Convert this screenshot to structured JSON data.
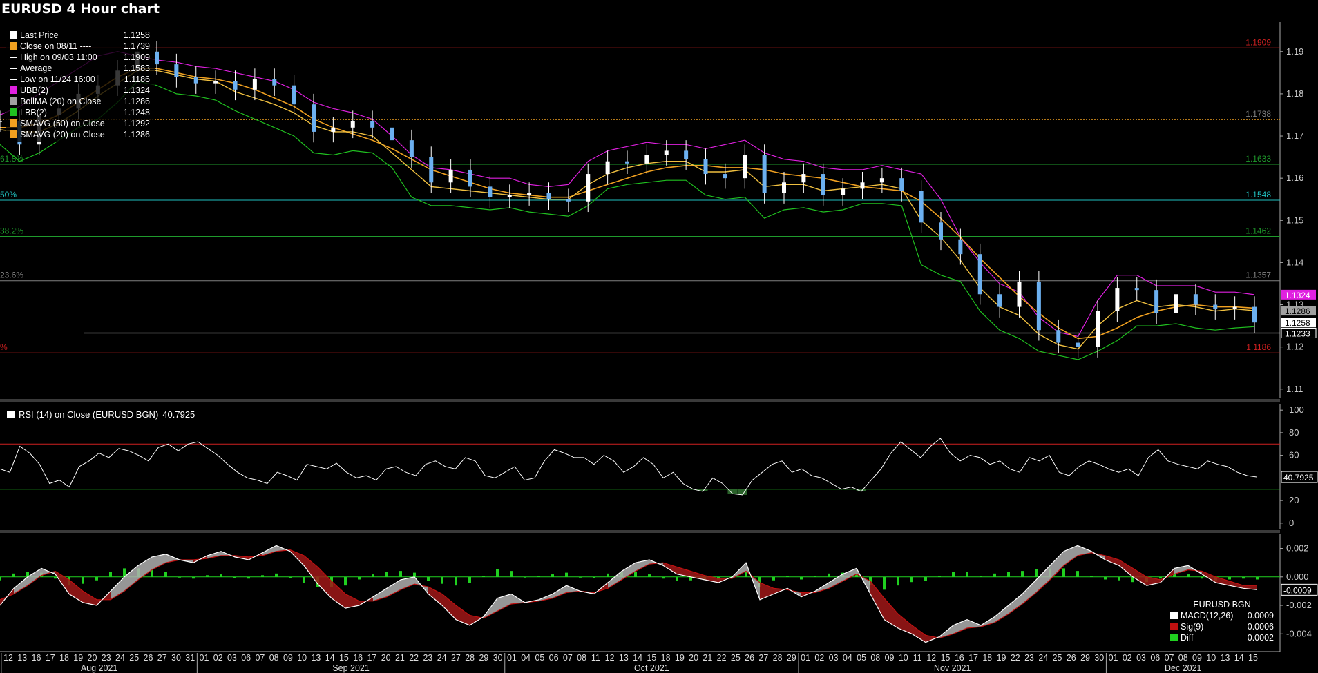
{
  "title": "EURUSD 4 Hour chart",
  "colors": {
    "price": "#6cb0f0",
    "upper_band": "#e020e0",
    "lower_band": "#20c020",
    "sma50": "#f0a020",
    "sma20": "#f0c040",
    "fib_red": "#d02020",
    "fib_green": "#1f9a2c",
    "fib_cyan": "#20c0c0",
    "fib_gray": "#808080",
    "rsi": "#ffffff",
    "macd": "#ffffff",
    "signal": "#c01010",
    "diff": "#20d020"
  },
  "legend": [
    {
      "label": "Last Price",
      "value": "1.1258",
      "color": "#ffffff",
      "icon": "square"
    },
    {
      "label": "Close on 08/11 ----",
      "value": "1.1739",
      "color": "#f0a020",
      "icon": "square"
    },
    {
      "label": "High on 09/03 11:00",
      "value": "1.1909",
      "color": "#ffffff",
      "icon": "high-marker-icon"
    },
    {
      "label": "Average",
      "value": "1.1583",
      "color": "#ffffff",
      "icon": "average-marker-icon"
    },
    {
      "label": "Low on 11/24 16:00",
      "value": "1.1186",
      "color": "#ffffff",
      "icon": "low-marker-icon"
    },
    {
      "label": "UBB(2)",
      "value": "1.1324",
      "color": "#e020e0",
      "icon": "square"
    },
    {
      "label": "BollMA (20)  on Close",
      "value": "1.1286",
      "color": "#a0a0a0",
      "icon": "square"
    },
    {
      "label": "LBB(2)",
      "value": "1.1248",
      "color": "#20c020",
      "icon": "square"
    },
    {
      "label": "SMAVG (50)  on Close",
      "value": "1.1292",
      "color": "#f0a020",
      "icon": "square"
    },
    {
      "label": "SMAVG (20)  on Close",
      "value": "1.1286",
      "color": "#f0a020",
      "icon": "square"
    }
  ],
  "fib_labels": [
    {
      "text": "",
      "value": 1.1909,
      "color": "#d02020",
      "right": "1.1909"
    },
    {
      "text": "61.8%",
      "value": 1.1633,
      "color": "#1f9a2c",
      "right": "1.1633"
    },
    {
      "text": "50%",
      "value": 1.1548,
      "color": "#20c0c0",
      "right": "1.1548"
    },
    {
      "text": "38.2%",
      "value": 1.1462,
      "color": "#1f9a2c",
      "right": "1.1462"
    },
    {
      "text": "23.6%",
      "value": 1.1357,
      "color": "#808080",
      "right": "1.1357"
    },
    {
      "text": "%",
      "value": 1.1186,
      "color": "#d02020",
      "right": "1.1186"
    }
  ],
  "close_line": {
    "value": 1.1739,
    "label": "1.1738"
  },
  "support_line": {
    "value": 1.1233
  },
  "price_badges": [
    {
      "text": "1.1324",
      "value": 1.1324,
      "bg": "#e020e0",
      "fg": "#ffffff"
    },
    {
      "text": "1.1286",
      "value": 1.1286,
      "bg": "#a0a0a0",
      "fg": "#000000"
    },
    {
      "text": "1.1258",
      "value": 1.1258,
      "bg": "#ffffff",
      "fg": "#000000"
    },
    {
      "text": "1.1233",
      "value": 1.1233,
      "bg": "#000000",
      "fg": "#ffffff"
    }
  ],
  "rsi_legend": {
    "label": "RSI (14)  on Close (EURUSD BGN)",
    "value": "40.7925"
  },
  "rsi_badge": "40.7925",
  "macd_legend": {
    "header": "EURUSD BGN",
    "rows": [
      {
        "label": "MACD(12,26)",
        "value": "-0.0009",
        "color": "#ffffff"
      },
      {
        "label": "Sig(9)",
        "value": "-0.0006",
        "color": "#c01010"
      },
      {
        "label": "Diff",
        "value": "-0.0002",
        "color": "#20d020"
      }
    ]
  },
  "macd_badge": "-0.0009",
  "chart_data": {
    "type": "line",
    "price_panel": {
      "ylim": [
        1.108,
        1.197
      ],
      "yticks": [
        "1.11",
        "1.12",
        "1.13",
        "1.14",
        "1.15",
        "1.16",
        "1.17",
        "1.18",
        "1.19"
      ],
      "close": [
        1.1735,
        1.168,
        1.175,
        1.1765,
        1.18,
        1.182,
        1.1855,
        1.19,
        1.187,
        1.184,
        1.1825,
        1.183,
        1.181,
        1.1835,
        1.182,
        1.1775,
        1.171,
        1.172,
        1.1735,
        1.172,
        1.169,
        1.165,
        1.159,
        1.162,
        1.158,
        1.1555,
        1.156,
        1.1565,
        1.155,
        1.1545,
        1.161,
        1.164,
        1.1635,
        1.1655,
        1.1665,
        1.1645,
        1.161,
        1.16,
        1.1655,
        1.1565,
        1.159,
        1.161,
        1.156,
        1.1575,
        1.159,
        1.16,
        1.157,
        1.1495,
        1.1455,
        1.142,
        1.1325,
        1.1295,
        1.1355,
        1.124,
        1.121,
        1.12,
        1.1285,
        1.134,
        1.1335,
        1.128,
        1.1325,
        1.13,
        1.129,
        1.1295,
        1.1258
      ],
      "upper_band": [
        1.175,
        1.177,
        1.18,
        1.183,
        1.186,
        1.189,
        1.19,
        1.189,
        1.188,
        1.1875,
        1.1865,
        1.186,
        1.185,
        1.184,
        1.183,
        1.181,
        1.178,
        1.1765,
        1.1755,
        1.174,
        1.17,
        1.1655,
        1.1625,
        1.162,
        1.161,
        1.16,
        1.16,
        1.1585,
        1.158,
        1.1585,
        1.164,
        1.1665,
        1.1675,
        1.1685,
        1.168,
        1.168,
        1.167,
        1.168,
        1.169,
        1.166,
        1.1645,
        1.164,
        1.1625,
        1.162,
        1.162,
        1.163,
        1.162,
        1.161,
        1.155,
        1.146,
        1.14,
        1.135,
        1.133,
        1.127,
        1.1235,
        1.1225,
        1.131,
        1.137,
        1.137,
        1.1345,
        1.1345,
        1.1345,
        1.133,
        1.133,
        1.1324
      ],
      "lower_band": [
        1.168,
        1.164,
        1.166,
        1.169,
        1.172,
        1.174,
        1.178,
        1.183,
        1.182,
        1.18,
        1.1795,
        1.1785,
        1.176,
        1.174,
        1.172,
        1.17,
        1.166,
        1.1655,
        1.1665,
        1.166,
        1.1625,
        1.1555,
        1.1535,
        1.1535,
        1.153,
        1.1525,
        1.153,
        1.152,
        1.1515,
        1.151,
        1.1535,
        1.1575,
        1.1585,
        1.159,
        1.1595,
        1.1595,
        1.156,
        1.155,
        1.1555,
        1.1505,
        1.1525,
        1.153,
        1.152,
        1.1525,
        1.154,
        1.154,
        1.1535,
        1.1395,
        1.137,
        1.1355,
        1.1285,
        1.124,
        1.122,
        1.119,
        1.118,
        1.117,
        1.119,
        1.1215,
        1.125,
        1.125,
        1.1255,
        1.1245,
        1.124,
        1.1245,
        1.1248
      ],
      "sma50": [
        1.172,
        1.172,
        1.173,
        1.175,
        1.178,
        1.181,
        1.184,
        1.186,
        1.186,
        1.185,
        1.184,
        1.1835,
        1.1825,
        1.181,
        1.179,
        1.177,
        1.174,
        1.172,
        1.1705,
        1.169,
        1.167,
        1.1645,
        1.162,
        1.1605,
        1.159,
        1.1575,
        1.1565,
        1.156,
        1.1555,
        1.1555,
        1.157,
        1.1585,
        1.16,
        1.1615,
        1.1625,
        1.163,
        1.163,
        1.1625,
        1.1625,
        1.162,
        1.161,
        1.1605,
        1.16,
        1.159,
        1.158,
        1.1575,
        1.157,
        1.1545,
        1.1505,
        1.146,
        1.141,
        1.1365,
        1.132,
        1.128,
        1.1245,
        1.122,
        1.1225,
        1.1245,
        1.127,
        1.1285,
        1.1295,
        1.13,
        1.1295,
        1.1295,
        1.1292
      ],
      "sma20": [
        1.1715,
        1.171,
        1.171,
        1.173,
        1.176,
        1.1795,
        1.1825,
        1.1855,
        1.1855,
        1.1845,
        1.1835,
        1.183,
        1.1805,
        1.179,
        1.1775,
        1.1755,
        1.1725,
        1.171,
        1.171,
        1.17,
        1.166,
        1.162,
        1.158,
        1.1575,
        1.157,
        1.1565,
        1.156,
        1.1555,
        1.155,
        1.155,
        1.1585,
        1.161,
        1.1625,
        1.1635,
        1.164,
        1.164,
        1.1615,
        1.1615,
        1.162,
        1.158,
        1.1585,
        1.1585,
        1.157,
        1.1575,
        1.158,
        1.1585,
        1.1575,
        1.15,
        1.146,
        1.1405,
        1.134,
        1.1295,
        1.1275,
        1.123,
        1.1205,
        1.1195,
        1.125,
        1.129,
        1.131,
        1.1295,
        1.13,
        1.1295,
        1.1285,
        1.129,
        1.1286
      ]
    },
    "rsi_panel": {
      "ylim": [
        -5,
        105
      ],
      "yticks": [
        "0",
        "20",
        "40",
        "60",
        "80",
        "100"
      ],
      "overbought": 70,
      "oversold": 30,
      "values": [
        48,
        45,
        68,
        62,
        52,
        35,
        38,
        32,
        50,
        55,
        62,
        58,
        66,
        64,
        60,
        55,
        67,
        70,
        64,
        70,
        72,
        66,
        60,
        52,
        45,
        40,
        38,
        35,
        45,
        42,
        38,
        52,
        50,
        48,
        53,
        45,
        40,
        42,
        38,
        48,
        50,
        45,
        42,
        52,
        55,
        50,
        48,
        58,
        55,
        42,
        40,
        45,
        50,
        38,
        40,
        55,
        65,
        62,
        58,
        58,
        52,
        60,
        55,
        45,
        50,
        58,
        52,
        40,
        45,
        35,
        30,
        28,
        40,
        35,
        26,
        25,
        38,
        45,
        52,
        55,
        45,
        48,
        42,
        40,
        35,
        30,
        32,
        28,
        38,
        48,
        62,
        72,
        65,
        58,
        68,
        75,
        62,
        55,
        60,
        58,
        52,
        55,
        48,
        45,
        58,
        55,
        60,
        45,
        42,
        50,
        55,
        52,
        48,
        45,
        48,
        42,
        58,
        65,
        55,
        52,
        50,
        48,
        55,
        52,
        50,
        45,
        42,
        40.79
      ]
    },
    "macd_panel": {
      "ylim": [
        -0.0052,
        0.0029
      ],
      "yticks": [
        "-0.004",
        "-0.002",
        "0.000",
        "0.002"
      ],
      "macd": [
        -0.002,
        -0.0008,
        0.0,
        0.0006,
        0.0002,
        -0.0012,
        -0.0018,
        -0.002,
        -0.001,
        0.0,
        0.0008,
        0.0014,
        0.0016,
        0.0012,
        0.001,
        0.0015,
        0.0018,
        0.0014,
        0.0012,
        0.0017,
        0.0022,
        0.0018,
        0.0008,
        -0.0005,
        -0.0015,
        -0.0022,
        -0.002,
        -0.0014,
        -0.0008,
        -0.0002,
        0.0,
        -0.0012,
        -0.002,
        -0.003,
        -0.0034,
        -0.0028,
        -0.0015,
        -0.0012,
        -0.0018,
        -0.0016,
        -0.0012,
        -0.0006,
        -0.001,
        -0.0012,
        -0.0004,
        0.0004,
        0.001,
        0.0012,
        0.0008,
        0.0002,
        0.0,
        -0.0002,
        -0.0004,
        0.0,
        0.001,
        -0.0016,
        -0.0012,
        -0.0008,
        -0.0014,
        -0.001,
        -0.0004,
        0.0002,
        0.0006,
        -0.0012,
        -0.003,
        -0.0036,
        -0.004,
        -0.0046,
        -0.0042,
        -0.0034,
        -0.003,
        -0.0034,
        -0.0028,
        -0.002,
        -0.0012,
        -0.0002,
        0.0008,
        0.0018,
        0.0022,
        0.0018,
        0.0012,
        0.0008,
        0.0,
        -0.0006,
        -0.0004,
        0.0006,
        0.0008,
        0.0002,
        -0.0004,
        -0.0006,
        -0.0008,
        -0.0009
      ],
      "signal": [
        -0.0016,
        -0.0012,
        -0.0006,
        0.0001,
        0.0004,
        -0.0002,
        -0.001,
        -0.0016,
        -0.0016,
        -0.001,
        -0.0002,
        0.0005,
        0.001,
        0.0012,
        0.0012,
        0.0013,
        0.0015,
        0.0015,
        0.0014,
        0.0015,
        0.0018,
        0.0019,
        0.0015,
        0.0007,
        -0.0003,
        -0.0012,
        -0.0017,
        -0.0017,
        -0.0014,
        -0.0009,
        -0.0005,
        -0.0007,
        -0.0012,
        -0.002,
        -0.0027,
        -0.0029,
        -0.0024,
        -0.0019,
        -0.0018,
        -0.0017,
        -0.0015,
        -0.0011,
        -0.001,
        -0.0011,
        -0.0008,
        -0.0002,
        0.0004,
        0.0009,
        0.001,
        0.0007,
        0.0004,
        0.0001,
        -0.0001,
        -0.0001,
        0.0004,
        -0.0004,
        -0.0008,
        -0.0009,
        -0.0011,
        -0.0011,
        -0.0008,
        -0.0003,
        0.0002,
        -0.0003,
        -0.0015,
        -0.0026,
        -0.0034,
        -0.0041,
        -0.0043,
        -0.004,
        -0.0036,
        -0.0035,
        -0.0032,
        -0.0026,
        -0.0019,
        -0.0011,
        -0.0002,
        0.0008,
        0.0015,
        0.0017,
        0.0015,
        0.0012,
        0.0006,
        0.0,
        -0.0002,
        0.0002,
        0.0005,
        0.0004,
        0.0,
        -0.0003,
        -0.0006,
        -0.0006
      ]
    },
    "x_days": [
      "12",
      "13",
      "16",
      "17",
      "18",
      "19",
      "20",
      "23",
      "24",
      "25",
      "26",
      "27",
      "30",
      "31",
      "01",
      "02",
      "03",
      "06",
      "07",
      "08",
      "09",
      "10",
      "13",
      "14",
      "15",
      "16",
      "17",
      "20",
      "21",
      "22",
      "23",
      "24",
      "27",
      "28",
      "29",
      "30",
      "01",
      "04",
      "05",
      "06",
      "07",
      "08",
      "11",
      "12",
      "13",
      "14",
      "15",
      "18",
      "19",
      "20",
      "21",
      "22",
      "25",
      "26",
      "27",
      "28",
      "29",
      "01",
      "02",
      "03",
      "04",
      "05",
      "08",
      "09",
      "10",
      "11",
      "12",
      "15",
      "16",
      "17",
      "18",
      "19",
      "22",
      "23",
      "24",
      "25",
      "26",
      "29",
      "30",
      "01",
      "02",
      "03",
      "06",
      "07",
      "08",
      "09",
      "10",
      "13",
      "14",
      "15"
    ],
    "x_months": [
      {
        "label": "Aug 2021",
        "start": 0,
        "end": 13
      },
      {
        "label": "Sep 2021",
        "start": 14,
        "end": 35
      },
      {
        "label": "Oct 2021",
        "start": 36,
        "end": 56
      },
      {
        "label": "Nov 2021",
        "start": 57,
        "end": 78
      },
      {
        "label": "Dec 2021",
        "start": 79,
        "end": 89
      }
    ]
  }
}
